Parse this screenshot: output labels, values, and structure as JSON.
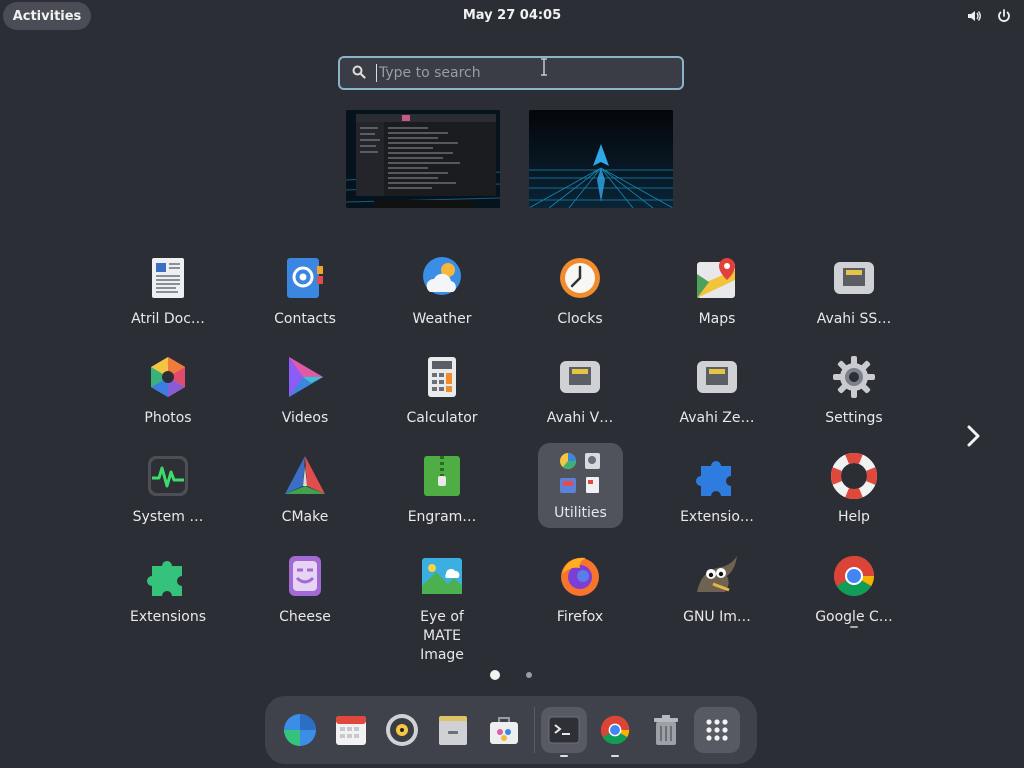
{
  "topbar": {
    "activities": "Activities",
    "clock": "May 27  04:05",
    "icons": [
      "volume-icon",
      "power-icon"
    ]
  },
  "search": {
    "placeholder": "Type to search"
  },
  "windows": [
    "terminal-window-thumbnail",
    "wallpaper-window-thumbnail"
  ],
  "apps": [
    {
      "label": "Atril Doc…",
      "icon": "document-viewer-icon"
    },
    {
      "label": "Contacts",
      "icon": "contacts-icon"
    },
    {
      "label": "Weather",
      "icon": "weather-icon"
    },
    {
      "label": "Clocks",
      "icon": "clocks-icon"
    },
    {
      "label": "Maps",
      "icon": "maps-icon"
    },
    {
      "label": "Avahi SS…",
      "icon": "network-icon"
    },
    {
      "label": "Photos",
      "icon": "photos-icon"
    },
    {
      "label": "Videos",
      "icon": "videos-icon"
    },
    {
      "label": "Calculator",
      "icon": "calculator-icon"
    },
    {
      "label": "Avahi V…",
      "icon": "network-icon"
    },
    {
      "label": "Avahi Ze…",
      "icon": "network-icon"
    },
    {
      "label": "Settings",
      "icon": "gear-icon"
    },
    {
      "label": "System …",
      "icon": "system-monitor-icon"
    },
    {
      "label": "CMake",
      "icon": "cmake-icon"
    },
    {
      "label": "Engram…",
      "icon": "archive-icon"
    },
    {
      "label": "Utilities",
      "icon": "folder-icon"
    },
    {
      "label": "Extensio…",
      "icon": "puzzle-icon"
    },
    {
      "label": "Help",
      "icon": "lifebuoy-icon"
    },
    {
      "label": "Extensions",
      "icon": "puzzle-green-icon"
    },
    {
      "label": "Cheese",
      "icon": "cheese-icon"
    },
    {
      "label": "Eye of MATE Image",
      "icon": "image-viewer-icon"
    },
    {
      "label": "Firefox",
      "icon": "firefox-icon"
    },
    {
      "label": "GNU Im…",
      "icon": "gimp-icon"
    },
    {
      "label": "Google C…",
      "icon": "chrome-icon"
    }
  ],
  "page_indicator": {
    "pages": 2,
    "current": 1
  },
  "dock": [
    "browser-icon",
    "calendar-icon",
    "music-icon",
    "files-icon",
    "software-icon",
    "terminal-icon",
    "chrome-icon",
    "trash-icon",
    "app-grid-icon"
  ]
}
